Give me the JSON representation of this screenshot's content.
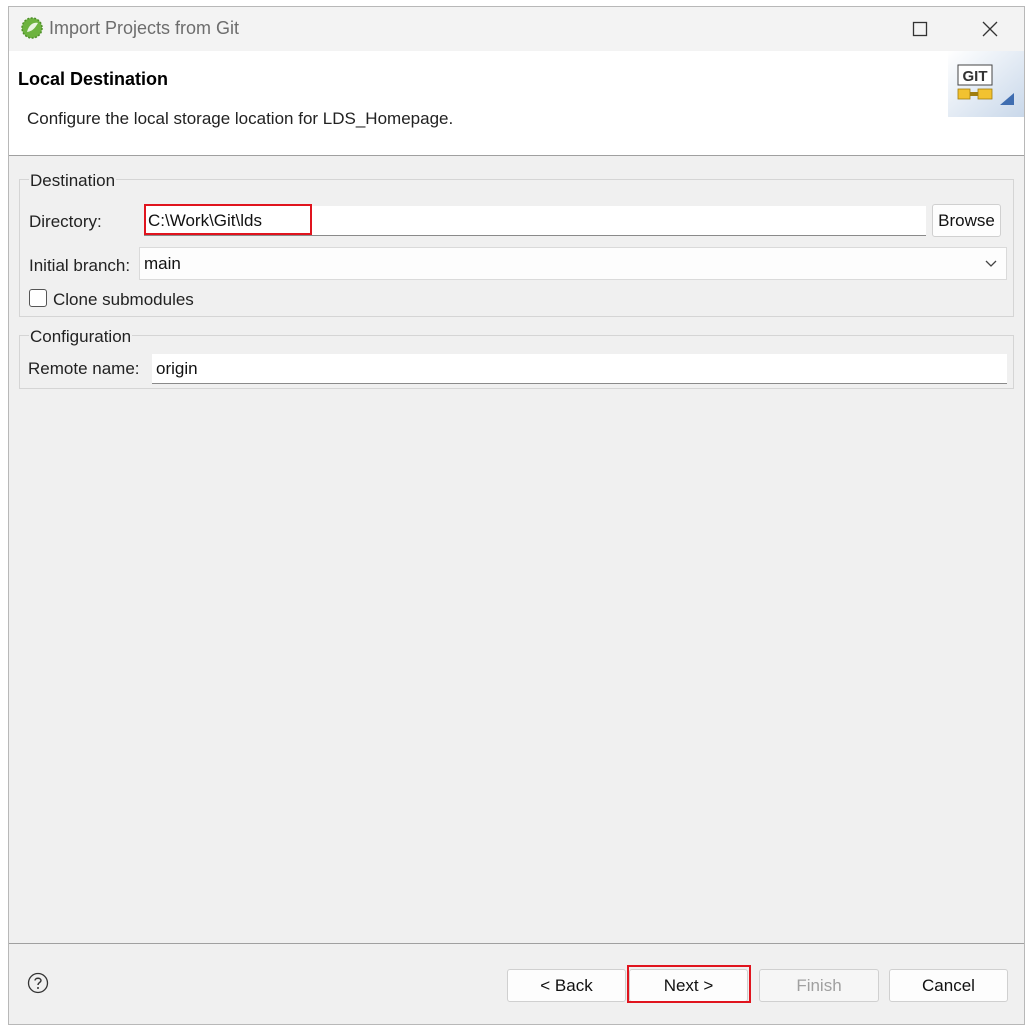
{
  "window": {
    "title": "Import Projects from Git"
  },
  "header": {
    "title": "Local Destination",
    "description": "Configure the local storage location for LDS_Homepage.",
    "icon": "git-banner-icon",
    "icon_text": "GIT"
  },
  "destination": {
    "group_title": "Destination",
    "directory_label": "Directory:",
    "directory_value": "C:\\Work\\Git\\lds",
    "browse_label": "Browse",
    "branch_label": "Initial branch:",
    "branch_value": "main",
    "clone_submodules_label": "Clone submodules",
    "clone_submodules_checked": false
  },
  "configuration": {
    "group_title": "Configuration",
    "remote_label": "Remote name:",
    "remote_value": "origin"
  },
  "footer": {
    "help_icon": "question-icon",
    "back_label": "< Back",
    "next_label": "Next >",
    "finish_label": "Finish",
    "cancel_label": "Cancel"
  },
  "colors": {
    "highlight": "#e0141e",
    "background": "#f0f0f0"
  }
}
